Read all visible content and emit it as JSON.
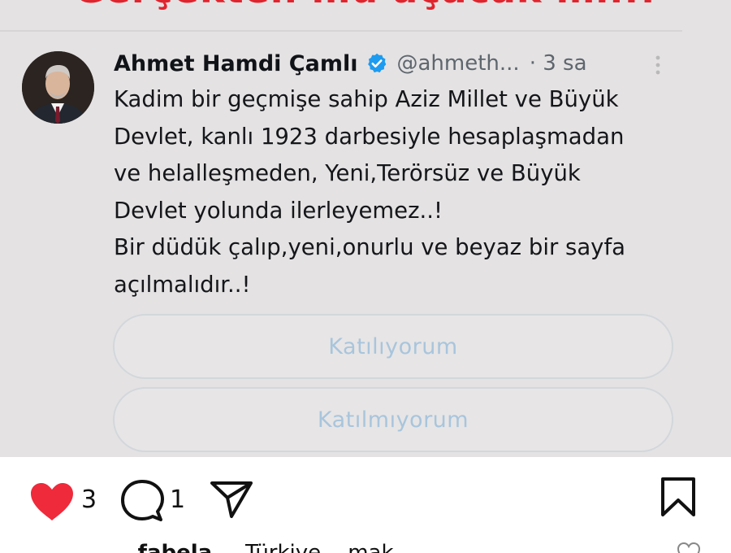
{
  "post": {
    "banner_text": "Gerçekten mu açacak mı..!",
    "tweet": {
      "author_name": "Ahmet Hamdi Çamlı",
      "handle": "@ahmeth...",
      "time": "· 3 sa",
      "lines": [
        "Kadim bir geçmişe sahip Aziz Millet  ve Büyük",
        "Devlet, kanlı 1923 darbesiyle hesaplaşmadan",
        "ve helalleşmeden, Yeni,Terörsüz ve Büyük",
        "Devlet yolunda ilerleyemez..!",
        "Bir düdük çalıp,yeni,onurlu ve beyaz bir sayfa",
        "açılmalıdır..!"
      ],
      "poll_options": [
        "Katılıyorum",
        "Katılmıyorum"
      ]
    }
  },
  "actions": {
    "like_count": "3",
    "comment_count": "1"
  },
  "caption": {
    "username": "...fabela",
    "text": "Türkiye ...mak..."
  },
  "colors": {
    "like": "#ee2a3b",
    "verified": "#1d9bf0",
    "banner": "#e0242e",
    "poll_text": "#a8c5dc"
  }
}
